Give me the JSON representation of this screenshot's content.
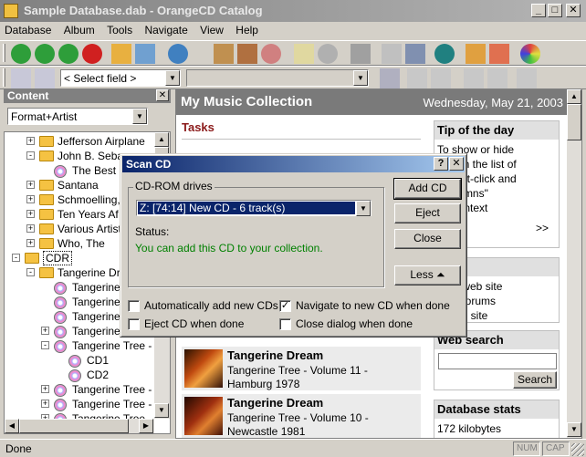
{
  "window": {
    "title": "Sample Database.dab - OrangeCD Catalog"
  },
  "menu": [
    "Database",
    "Album",
    "Tools",
    "Navigate",
    "View",
    "Help"
  ],
  "toolbar2": {
    "field_select": "< Select field >",
    "second_select": ""
  },
  "content_pane": {
    "header": "Content",
    "view_select": "Format+Artist",
    "tree": [
      {
        "label": "Jefferson Airplane",
        "type": "folder",
        "level": 1,
        "expander": "+"
      },
      {
        "label": "John B. Seba",
        "type": "folder",
        "level": 1,
        "expander": "-"
      },
      {
        "label": "The Best",
        "type": "cd",
        "level": 2,
        "expander": ""
      },
      {
        "label": "Santana",
        "type": "folder",
        "level": 1,
        "expander": "+"
      },
      {
        "label": "Schmoelling,",
        "type": "folder",
        "level": 1,
        "expander": "+"
      },
      {
        "label": "Ten Years Af",
        "type": "folder",
        "level": 1,
        "expander": "+"
      },
      {
        "label": "Various Artist",
        "type": "folder",
        "level": 1,
        "expander": "+"
      },
      {
        "label": "Who, The",
        "type": "folder",
        "level": 1,
        "expander": "+"
      },
      {
        "label": "CDR",
        "type": "folder",
        "level": 0,
        "expander": "-"
      },
      {
        "label": "Tangerine Dre",
        "type": "folder",
        "level": 1,
        "expander": "-"
      },
      {
        "label": "Tangerine",
        "type": "cd",
        "level": 2,
        "expander": ""
      },
      {
        "label": "Tangerine",
        "type": "cd",
        "level": 2,
        "expander": ""
      },
      {
        "label": "Tangerine",
        "type": "cd",
        "level": 2,
        "expander": ""
      },
      {
        "label": "Tangerine",
        "type": "cd",
        "level": 2,
        "expander": "+"
      },
      {
        "label": "Tangerine Tree -",
        "type": "cd",
        "level": 2,
        "expander": "-"
      },
      {
        "label": "CD1",
        "type": "cd",
        "level": 3,
        "expander": ""
      },
      {
        "label": "CD2",
        "type": "cd",
        "level": 3,
        "expander": ""
      },
      {
        "label": "Tangerine Tree -",
        "type": "cd",
        "level": 2,
        "expander": "+"
      },
      {
        "label": "Tangerine Tree -",
        "type": "cd",
        "level": 2,
        "expander": "+"
      },
      {
        "label": "Tangerine Tree -",
        "type": "cd",
        "level": 2,
        "expander": "+"
      }
    ]
  },
  "main": {
    "title": "My Music Collection",
    "date": "Wednesday, May 21, 2003",
    "tasks_heading": "Tasks",
    "tip": {
      "heading": "Tip of the day",
      "lines": [
        "To show or hide",
        "mns in the list of",
        "s, right-click and",
        "\"Columns\"",
        "he context"
      ],
      "more": ">>"
    },
    "links": {
      "heading": "inks",
      "items": [
        "eCD web site",
        "eCD forums",
        "B web site"
      ]
    },
    "web_search": {
      "heading": "Web search",
      "button": "Search",
      "input": ""
    },
    "db_stats": {
      "heading": "Database stats",
      "value": "172 kilobytes"
    },
    "albums": [
      {
        "artist": "Tangerine Dream",
        "title": "Tangerine Tree - Volume 11 -",
        "subtitle": "Hamburg 1978"
      },
      {
        "artist": "Tangerine Dream",
        "title": "Tangerine Tree - Volume 10 -",
        "subtitle": "Newcastle 1981"
      }
    ]
  },
  "dialog": {
    "title": "Scan CD",
    "help_btn": "?",
    "close_btn": "✕",
    "group_label": "CD-ROM drives",
    "drive_select": "Z:  [74:14] New CD - 6 track(s)",
    "status_label": "Status:",
    "status_text": "You can add this CD to your collection.",
    "buttons": {
      "add": "Add CD",
      "eject": "Eject",
      "close": "Close",
      "less": "Less"
    },
    "options": [
      {
        "label": "Automatically add new CDs",
        "checked": false
      },
      {
        "label": "Navigate to new CD when done",
        "checked": true
      },
      {
        "label": "Eject CD when done",
        "checked": false
      },
      {
        "label": "Close dialog when done",
        "checked": false
      }
    ]
  },
  "statusbar": {
    "text": "Done",
    "num": "NUM",
    "cap": "CAP"
  },
  "colors": {
    "status_green": "#008000",
    "task_heading": "#8b1a1a",
    "dialog_title": "#0a246a"
  }
}
